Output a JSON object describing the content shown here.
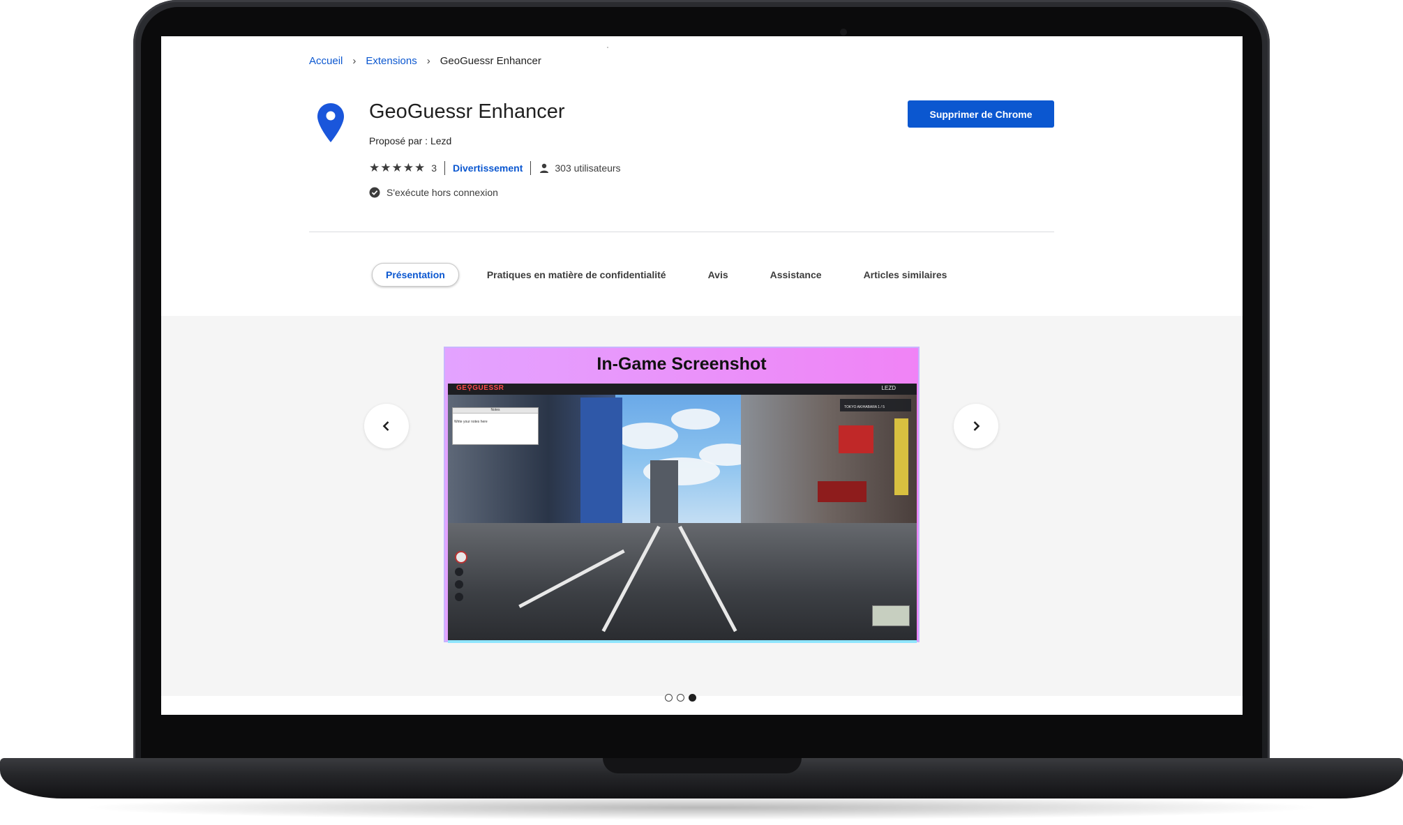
{
  "breadcrumb": {
    "home": "Accueil",
    "extensions": "Extensions",
    "current": "GeoGuessr Enhancer"
  },
  "app": {
    "title": "GeoGuessr Enhancer",
    "author": "Proposé par : Lezd",
    "rating_stars": "★★★★★",
    "rating_value": 5,
    "rating_count": "3",
    "category": "Divertissement",
    "users": "303 utilisateurs",
    "offline": "S'exécute hors connexion",
    "remove_button": "Supprimer de Chrome"
  },
  "tabs": [
    {
      "label": "Présentation",
      "active": true
    },
    {
      "label": "Pratiques en matière de confidentialité",
      "active": false
    },
    {
      "label": "Avis",
      "active": false
    },
    {
      "label": "Assistance",
      "active": false
    },
    {
      "label": "Articles similaires",
      "active": false
    }
  ],
  "gallery": {
    "slide_title": "In-Game Screenshot",
    "game_logo": "GE⚲GUESSR",
    "game_user": "LEZD",
    "hud_text": "TOKYO AKIHABARA  1 / 5",
    "notes_placeholder": "Write your notes here",
    "notes_header": "Notes",
    "current_slide": 3,
    "total_slides": 3
  },
  "icons": {
    "app": "map-pin-icon",
    "user": "person-icon",
    "offline": "check-circle-icon",
    "prev": "chevron-left-icon",
    "next": "chevron-right-icon"
  },
  "colors": {
    "accent": "#0b57d0",
    "pin": "#1a56db"
  }
}
